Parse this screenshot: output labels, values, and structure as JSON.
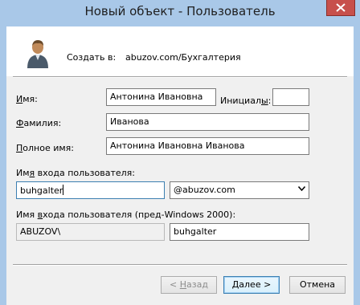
{
  "window": {
    "title": "Новый объект - Пользователь",
    "close_icon": "close-icon"
  },
  "header": {
    "create_in_label": "Создать в:",
    "create_in_path": "abuzov.com/Бухгалтерия",
    "icon": "user-icon"
  },
  "form": {
    "first_name": {
      "label_pre": "",
      "label_ul": "И",
      "label_post": "мя:",
      "value": "Антонина Ивановна"
    },
    "initials": {
      "label_pre": "Инициал",
      "label_ul": "ы",
      "label_post": ":",
      "value": ""
    },
    "last_name": {
      "label_pre": "",
      "label_ul": "Ф",
      "label_post": "амилия:",
      "value": "Иванова"
    },
    "full_name": {
      "label_pre": "",
      "label_ul": "П",
      "label_post": "олное имя:",
      "value": "Антонина Ивановна Иванова"
    },
    "logon_name": {
      "label_pre": "Им",
      "label_ul": "я",
      "label_post": " входа пользователя:",
      "value": "buhgalter"
    },
    "domain": {
      "selected": "@abuzov.com",
      "icon": "chevron-down-icon"
    },
    "pre2000": {
      "label_pre": "Имя ",
      "label_ul": "в",
      "label_post": "хода пользователя (пред-Windows 2000):",
      "domain_value": "ABUZOV\\",
      "value": "buhgalter"
    }
  },
  "buttons": {
    "back": {
      "pre": "< ",
      "ul": "Н",
      "post": "азад"
    },
    "next": {
      "pre": "",
      "ul": "Д",
      "post": "алее >"
    },
    "cancel": "Отмена"
  },
  "colors": {
    "titlebar": "#a9c8e8",
    "close": "#c7504b",
    "focus_border": "#3c7fb1"
  }
}
